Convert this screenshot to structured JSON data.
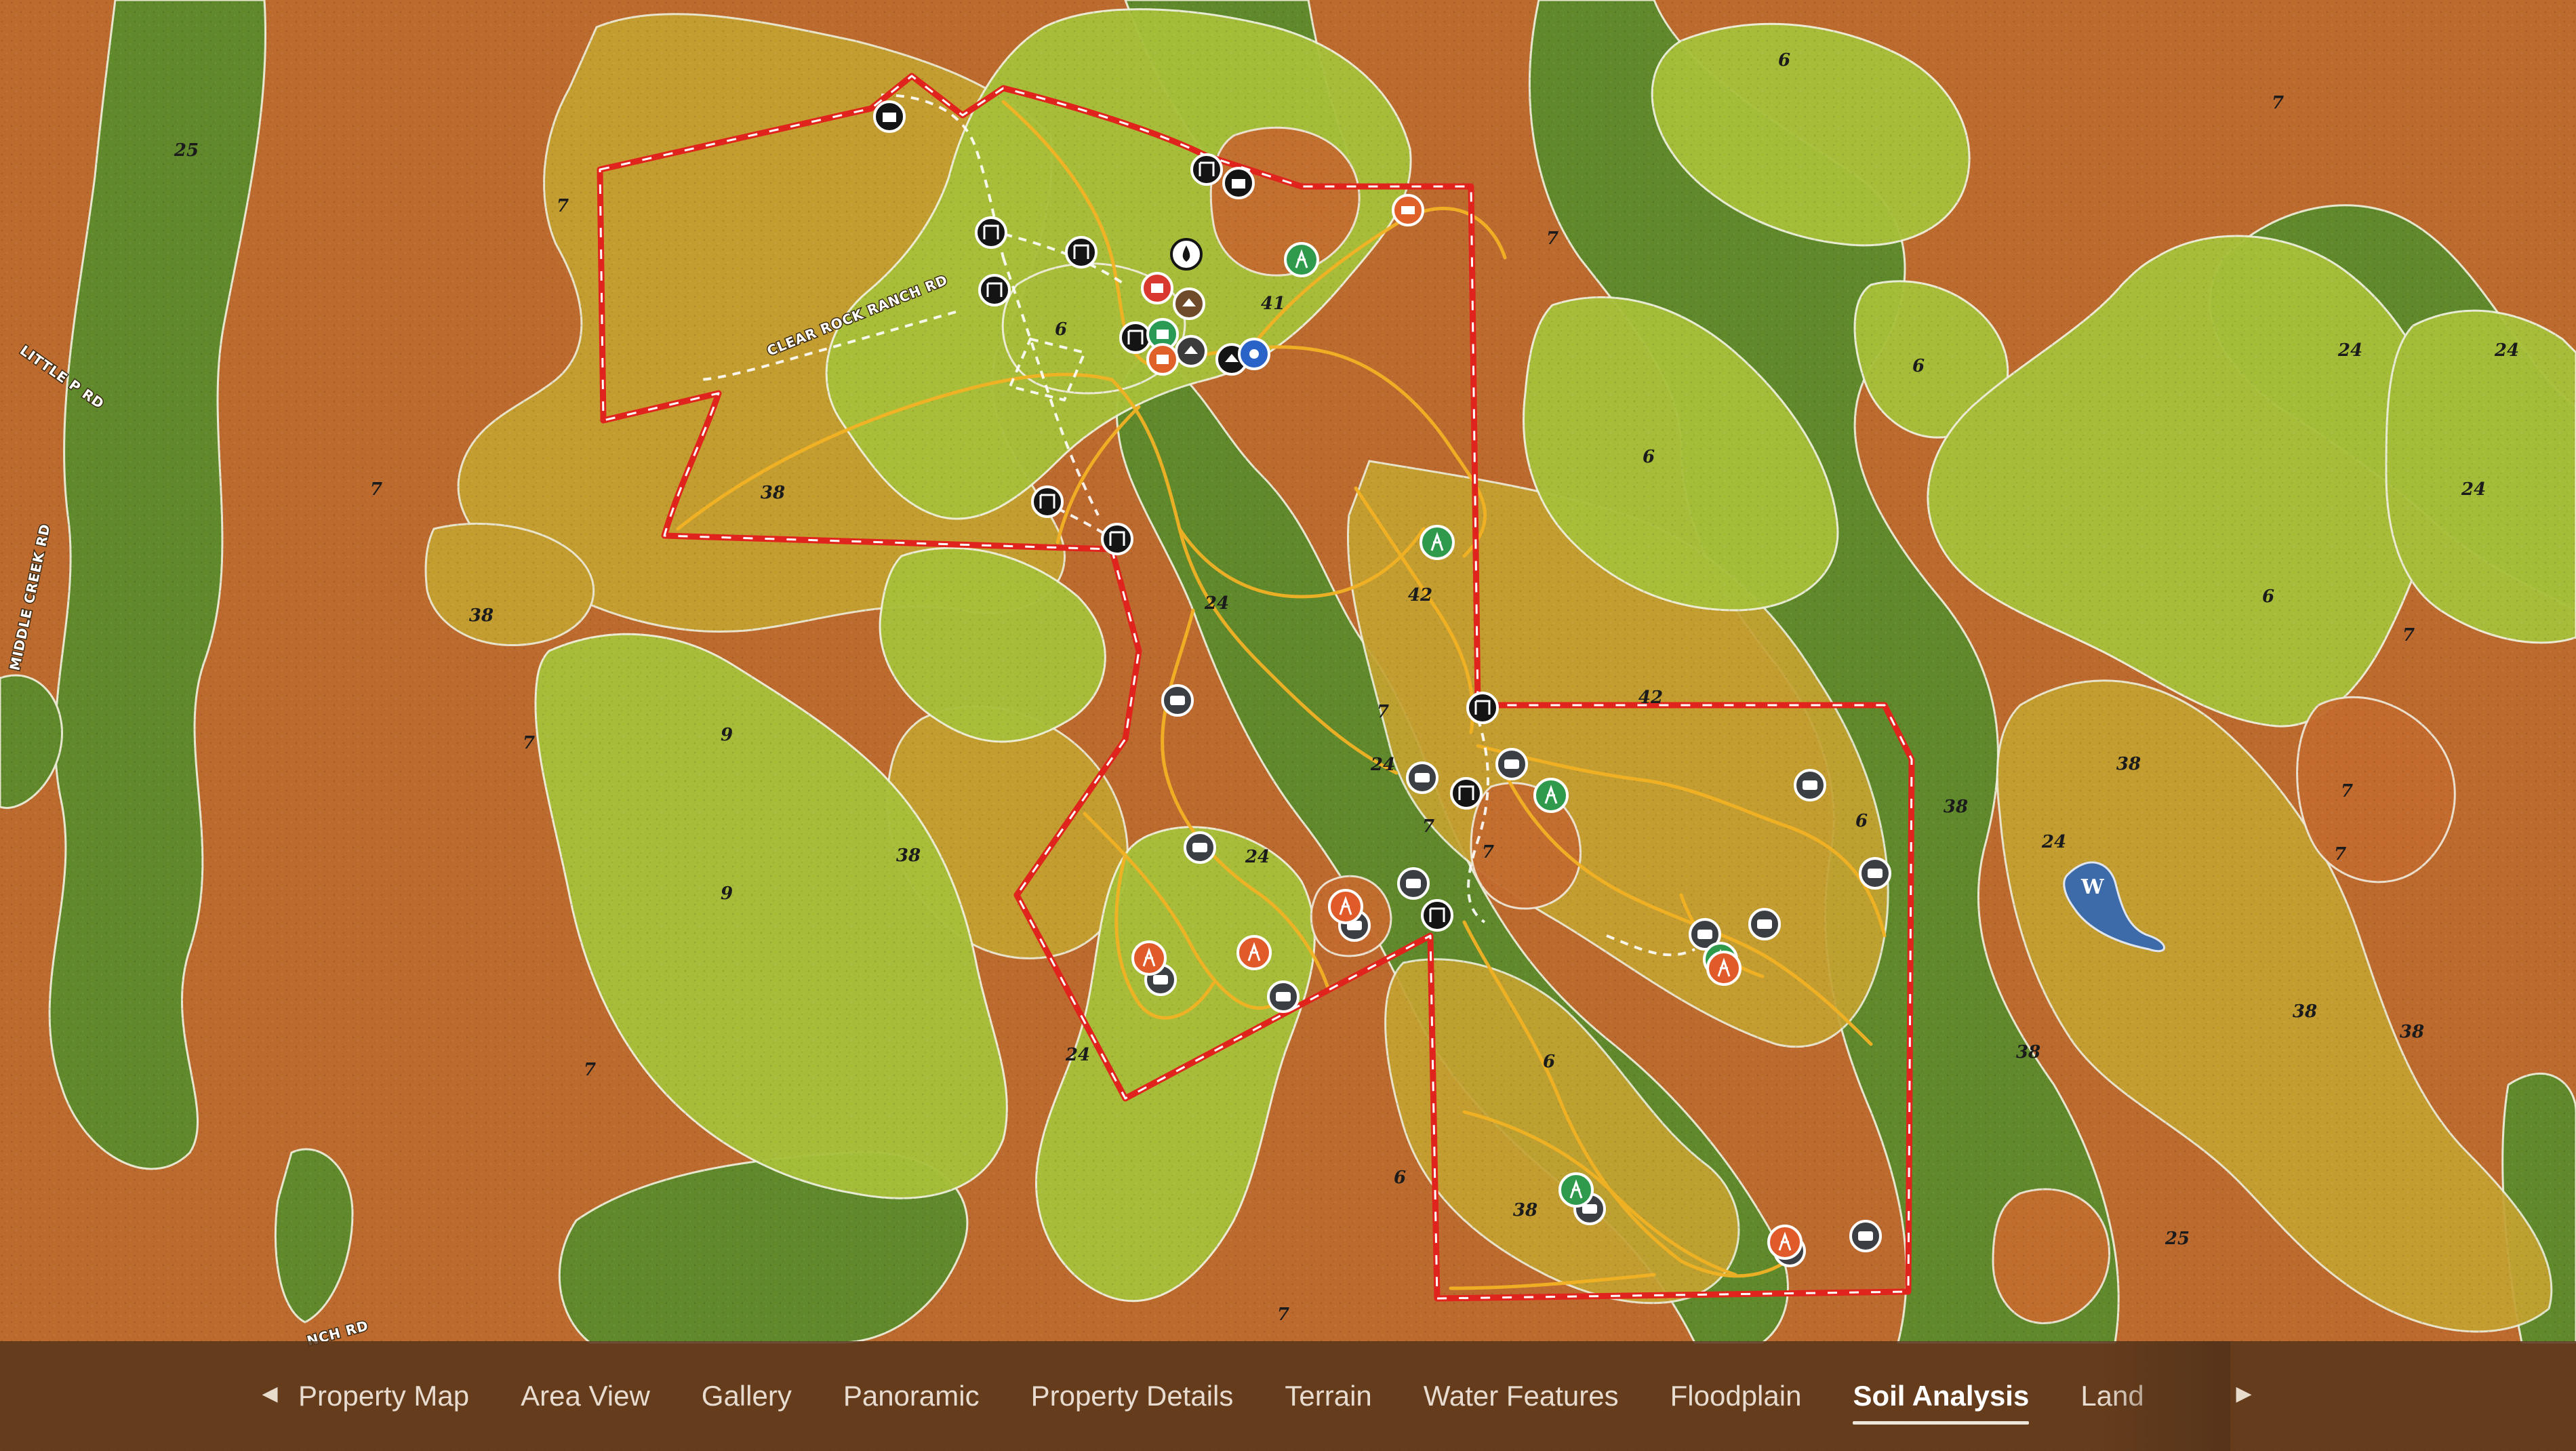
{
  "map": {
    "soil_labels": [
      "25",
      "7",
      "7",
      "7",
      "7",
      "38",
      "38",
      "38",
      "9",
      "9",
      "7",
      "6",
      "41",
      "24",
      "24",
      "24",
      "6",
      "6",
      "6",
      "6",
      "6",
      "24",
      "24",
      "42",
      "42",
      "7",
      "7",
      "7",
      "7",
      "38",
      "38",
      "38",
      "38",
      "38",
      "38",
      "24",
      "25",
      "7",
      "7",
      "7",
      "6",
      "6",
      "24",
      "24",
      "7"
    ],
    "road_labels": {
      "clear_rock": "CLEAR ROCK RANCH RD",
      "little_p": "LITTLE P RD",
      "middle_creek": "MIDDLE CREEK RD",
      "ranch_rd": "NCH RD"
    },
    "wetland_marker": "W",
    "boundary_color": "#e0231c",
    "trail_color": "#f2b224",
    "soil_colors": {
      "dark_green": "#5f8a2b",
      "light_green": "#a9c23b",
      "yellow_olive": "#c2a530",
      "orange": "#c0662d",
      "deep_orange": "#b45a27"
    }
  },
  "nav": {
    "prev_icon": "chevron-left-icon",
    "next_icon": "chevron-right-icon",
    "tabs": [
      {
        "label": "Property Map"
      },
      {
        "label": "Area View"
      },
      {
        "label": "Gallery"
      },
      {
        "label": "Panoramic"
      },
      {
        "label": "Property Details"
      },
      {
        "label": "Terrain"
      },
      {
        "label": "Water Features"
      },
      {
        "label": "Floodplain"
      },
      {
        "label": "Soil Analysis"
      },
      {
        "label": "Land"
      }
    ],
    "active_tab": "Soil Analysis"
  }
}
